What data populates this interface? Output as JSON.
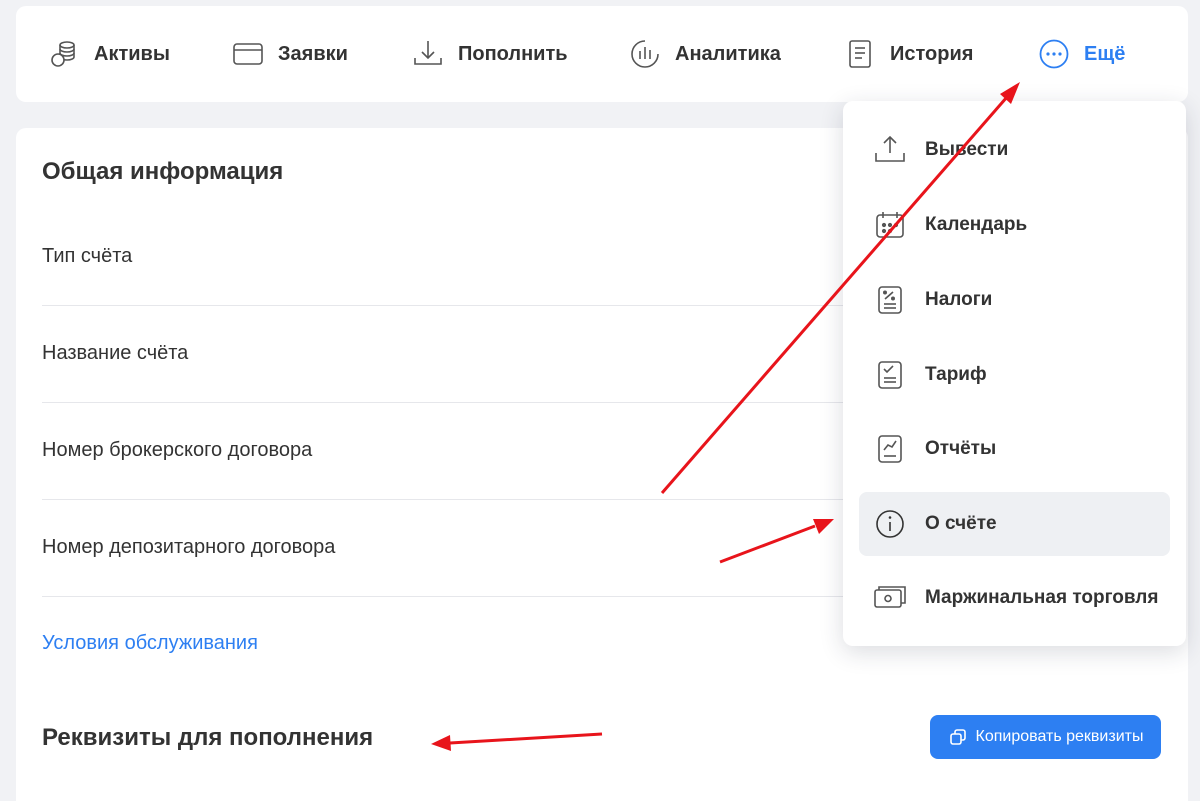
{
  "topnav": {
    "items": [
      {
        "label": "Активы",
        "icon": "coins-stack-icon"
      },
      {
        "label": "Заявки",
        "icon": "card-icon"
      },
      {
        "label": "Пополнить",
        "icon": "download-icon"
      },
      {
        "label": "Аналитика",
        "icon": "analytics-icon"
      },
      {
        "label": "История",
        "icon": "document-icon"
      },
      {
        "label": "Ещё",
        "icon": "more-dots-icon"
      }
    ]
  },
  "general": {
    "title": "Общая информация",
    "rows": [
      "Тип счёта",
      "Название счёта",
      "Номер брокерского договора",
      "Номер депозитарного договора"
    ],
    "link": "Условия обслуживания"
  },
  "requisites": {
    "title": "Реквизиты для пополнения",
    "copy_button": "Копировать реквизиты"
  },
  "more_menu": {
    "items": [
      {
        "label": "Вывести",
        "icon": "upload-icon"
      },
      {
        "label": "Календарь",
        "icon": "calendar-icon"
      },
      {
        "label": "Налоги",
        "icon": "tax-document-icon"
      },
      {
        "label": "Тариф",
        "icon": "tariff-document-icon"
      },
      {
        "label": "Отчёты",
        "icon": "report-chart-icon"
      },
      {
        "label": "О счёте",
        "icon": "info-icon",
        "active": true
      },
      {
        "label": "Маржинальная торговля",
        "icon": "cash-note-icon"
      }
    ]
  },
  "colors": {
    "accent": "#2d7ff2",
    "text": "#333333",
    "background": "#f1f2f5",
    "annotation_arrow": "#e8141b"
  }
}
